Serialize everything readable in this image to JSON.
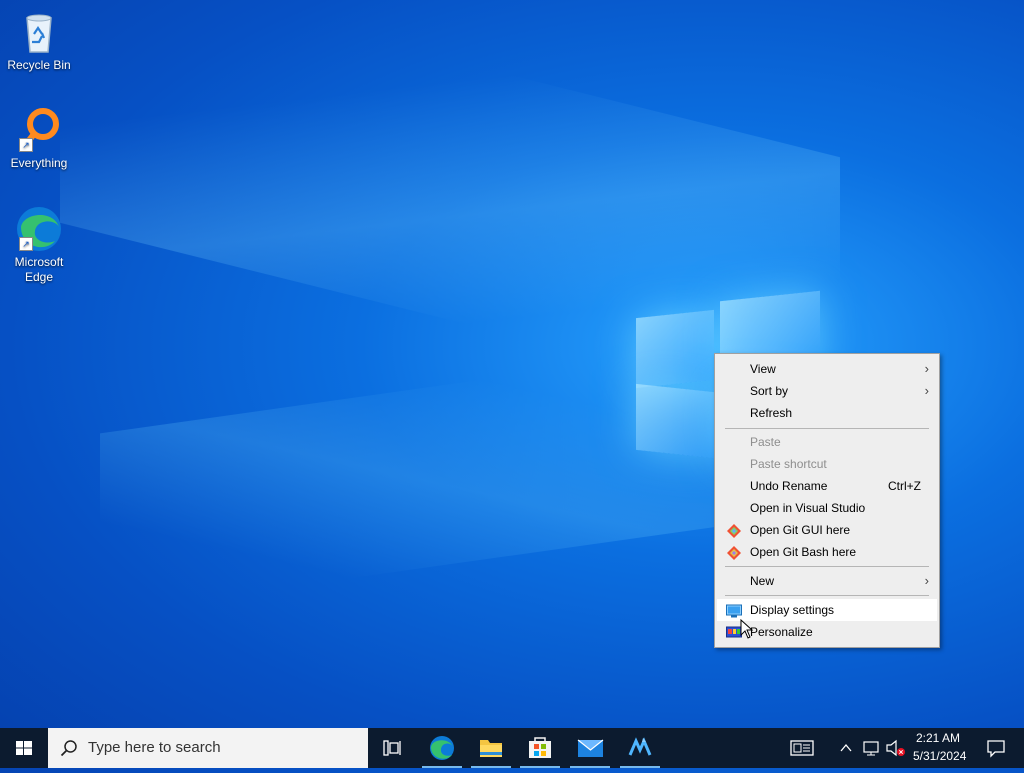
{
  "desktop": {
    "icons": [
      {
        "label": "Recycle Bin"
      },
      {
        "label": "Everything"
      },
      {
        "label": "Microsoft Edge"
      }
    ]
  },
  "context_menu": {
    "items": [
      {
        "label": "View",
        "submenu": true
      },
      {
        "label": "Sort by",
        "submenu": true
      },
      {
        "label": "Refresh"
      },
      {
        "label": "Paste",
        "disabled": true
      },
      {
        "label": "Paste shortcut",
        "disabled": true
      },
      {
        "label": "Undo Rename",
        "shortcut": "Ctrl+Z"
      },
      {
        "label": "Open in Visual Studio"
      },
      {
        "label": "Open Git GUI here",
        "icon": "git-gui-icon"
      },
      {
        "label": "Open Git Bash here",
        "icon": "git-bash-icon"
      },
      {
        "label": "New",
        "submenu": true
      },
      {
        "label": "Display settings",
        "icon": "display-icon",
        "highlighted": true
      },
      {
        "label": "Personalize",
        "icon": "personalize-icon"
      }
    ]
  },
  "taskbar": {
    "search_placeholder": "Type here to search",
    "pinned": [
      "task-view-icon",
      "edge-icon",
      "file-explorer-icon",
      "store-icon",
      "mail-icon",
      "visual-studio-installer-icon"
    ],
    "clock": {
      "time": "2:21 AM",
      "date": "5/31/2024"
    }
  },
  "colors": {
    "accent": "#76b9ed",
    "taskbar": "#0c1b2f",
    "menu_bg": "#eeeeee"
  }
}
